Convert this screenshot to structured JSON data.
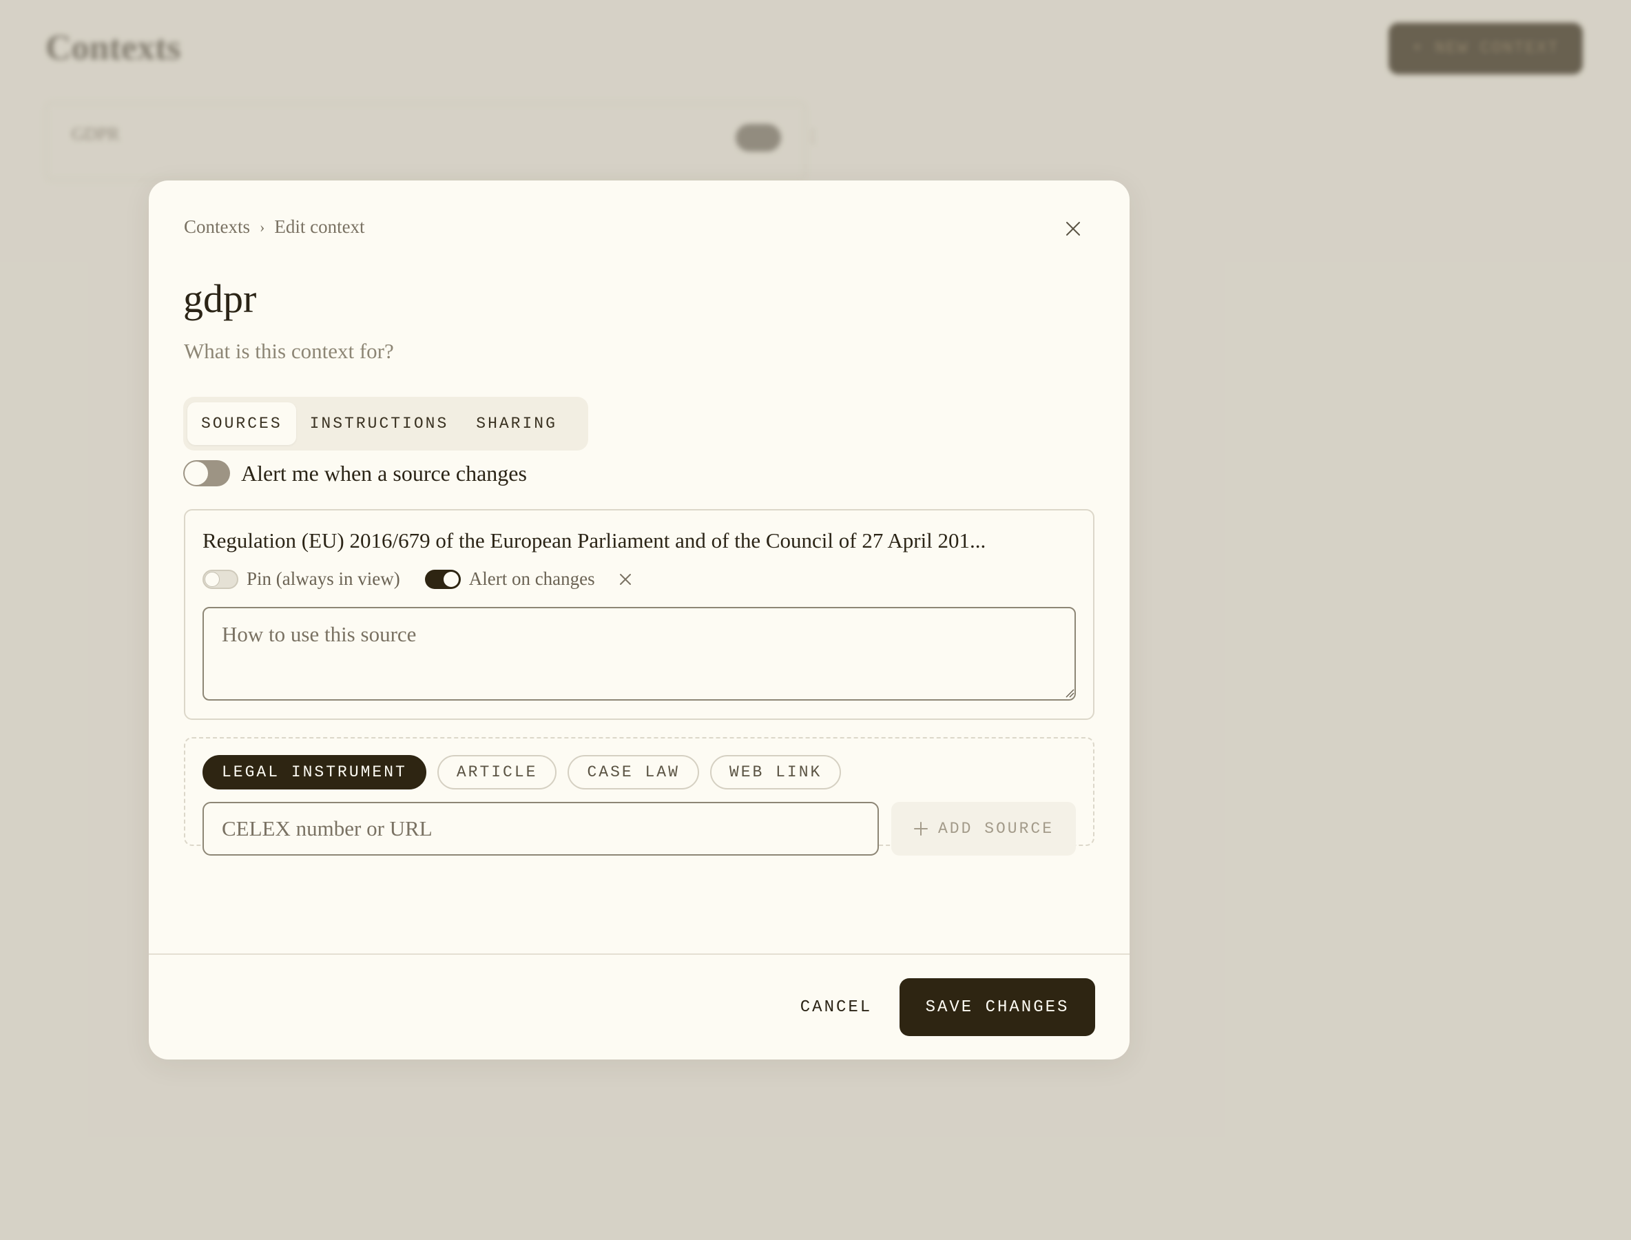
{
  "background": {
    "page_title": "Contexts",
    "new_button_label": "+ NEW CONTEXT",
    "card_label": "GDPR"
  },
  "modal": {
    "breadcrumb": {
      "root": "Contexts",
      "separator": "›",
      "current": "Edit context"
    },
    "title": "gdpr",
    "description_placeholder": "What is this context for?",
    "tabs": [
      {
        "label": "SOURCES",
        "active": true
      },
      {
        "label": "INSTRUCTIONS",
        "active": false
      },
      {
        "label": "SHARING",
        "active": false
      }
    ],
    "alert_toggle": {
      "label": "Alert me when a source changes",
      "on": false
    },
    "source": {
      "title": "Regulation (EU) 2016/679 of the European Parliament and of the Council of 27 April 201...",
      "pin_label": "Pin (always in view)",
      "pin_on": false,
      "alert_label": "Alert on changes",
      "alert_on": true,
      "notes_placeholder": "How to use this source"
    },
    "add_source": {
      "types": [
        {
          "label": "LEGAL INSTRUMENT",
          "active": true
        },
        {
          "label": "ARTICLE",
          "active": false
        },
        {
          "label": "CASE LAW",
          "active": false
        },
        {
          "label": "WEB LINK",
          "active": false
        }
      ],
      "input_placeholder": "CELEX number or URL",
      "button_label": "ADD SOURCE"
    },
    "footer": {
      "cancel_label": "CANCEL",
      "save_label": "SAVE CHANGES"
    }
  },
  "colors": {
    "backdrop": "#d6d2c6",
    "surface": "#fdfbf3",
    "primary": "#2e2512",
    "text": "#2b2416",
    "muted": "#7a7263"
  }
}
